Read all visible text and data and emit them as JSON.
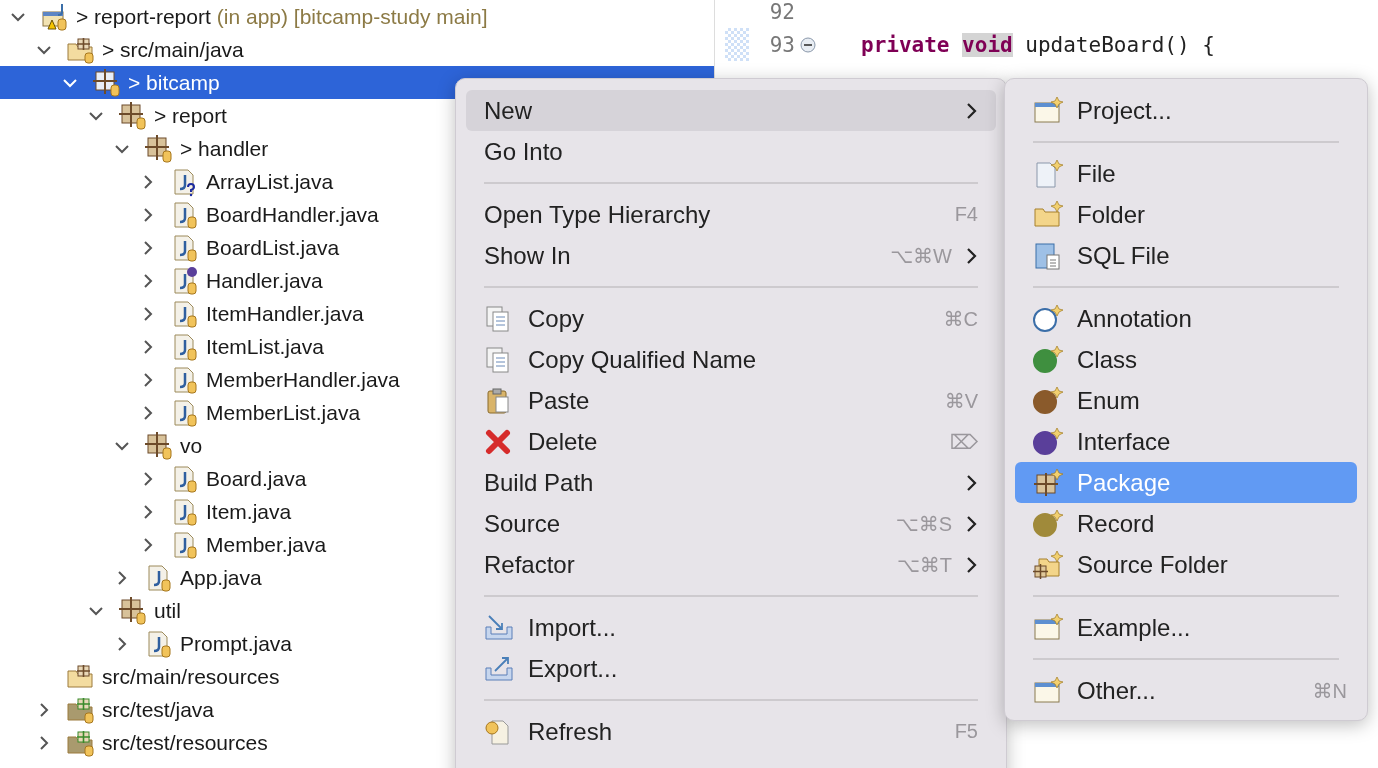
{
  "tree": [
    {
      "label": "> report-report",
      "decoration": "(in app) [bitcamp-study main]",
      "kind": "project",
      "expanded": true,
      "selected": false,
      "children": [
        {
          "label": "> src/main/java",
          "kind": "srcfolder",
          "expanded": true,
          "selected": false,
          "children": [
            {
              "label": "> bitcamp",
              "kind": "package",
              "expanded": true,
              "selected": true,
              "children": [
                {
                  "label": "> report",
                  "kind": "package",
                  "expanded": true,
                  "selected": false,
                  "children": [
                    {
                      "label": "> handler",
                      "kind": "package",
                      "expanded": true,
                      "selected": false,
                      "children": [
                        {
                          "label": "ArrayList.java",
                          "kind": "javaunknown",
                          "expanded": false,
                          "selected": false
                        },
                        {
                          "label": "BoardHandler.java",
                          "kind": "java",
                          "expanded": false,
                          "selected": false
                        },
                        {
                          "label": "BoardList.java",
                          "kind": "java",
                          "expanded": false,
                          "selected": false
                        },
                        {
                          "label": "Handler.java",
                          "kind": "javainterface",
                          "expanded": false,
                          "selected": false
                        },
                        {
                          "label": "ItemHandler.java",
                          "kind": "java",
                          "expanded": false,
                          "selected": false
                        },
                        {
                          "label": "ItemList.java",
                          "kind": "java",
                          "expanded": false,
                          "selected": false
                        },
                        {
                          "label": "MemberHandler.java",
                          "kind": "java",
                          "expanded": false,
                          "selected": false
                        },
                        {
                          "label": "MemberList.java",
                          "kind": "java",
                          "expanded": false,
                          "selected": false
                        }
                      ]
                    },
                    {
                      "label": "vo",
                      "kind": "package",
                      "expanded": true,
                      "selected": false,
                      "children": [
                        {
                          "label": "Board.java",
                          "kind": "java",
                          "expanded": false,
                          "selected": false
                        },
                        {
                          "label": "Item.java",
                          "kind": "java",
                          "expanded": false,
                          "selected": false
                        },
                        {
                          "label": "Member.java",
                          "kind": "java",
                          "expanded": false,
                          "selected": false
                        }
                      ]
                    },
                    {
                      "label": "App.java",
                      "kind": "java",
                      "expanded": false,
                      "selected": false
                    }
                  ]
                },
                {
                  "label": "util",
                  "kind": "package",
                  "expanded": true,
                  "selected": false,
                  "children": [
                    {
                      "label": "Prompt.java",
                      "kind": "java",
                      "expanded": false,
                      "selected": false
                    }
                  ]
                }
              ]
            }
          ]
        },
        {
          "label": "src/main/resources",
          "kind": "resfolder",
          "selected": false
        },
        {
          "label": "src/test/java",
          "kind": "testfolder",
          "expanded": false,
          "selected": false
        },
        {
          "label": "src/test/resources",
          "kind": "testfolder",
          "expanded": false,
          "selected": false
        }
      ]
    }
  ],
  "editor": {
    "lines": [
      {
        "number": "92"
      },
      {
        "number": "93",
        "folding": true,
        "tokens": [
          {
            "text": "private",
            "kind": "keyword"
          },
          {
            "text": "void",
            "kind": "occurrence"
          },
          {
            "text": "updateBoard() {",
            "kind": "plain"
          }
        ]
      }
    ]
  },
  "context_menu": {
    "items": [
      {
        "kind": "item",
        "label": "New",
        "submenu": true,
        "selected": true
      },
      {
        "kind": "item",
        "label": "Go Into",
        "selected": false
      },
      {
        "kind": "separator"
      },
      {
        "kind": "item",
        "label": "Open Type Hierarchy",
        "shortcut": "F4",
        "selected": false
      },
      {
        "kind": "item",
        "label": "Show In",
        "shortcut": "⌥⌘W",
        "submenu": true,
        "selected": false
      },
      {
        "kind": "separator"
      },
      {
        "kind": "item",
        "label": "Copy",
        "shortcut": "⌘C",
        "selected": false
      },
      {
        "kind": "item",
        "label": "Copy Qualified Name",
        "selected": false
      },
      {
        "kind": "item",
        "label": "Paste",
        "shortcut": "⌘V",
        "selected": false
      },
      {
        "kind": "item",
        "label": "Delete",
        "shortcut": "⌦",
        "selected": false
      },
      {
        "kind": "item",
        "label": "Build Path",
        "submenu": true,
        "selected": false
      },
      {
        "kind": "item",
        "label": "Source",
        "shortcut": "⌥⌘S",
        "submenu": true,
        "selected": false
      },
      {
        "kind": "item",
        "label": "Refactor",
        "shortcut": "⌥⌘T",
        "submenu": true,
        "selected": false
      },
      {
        "kind": "separator"
      },
      {
        "kind": "item",
        "label": "Import...",
        "selected": false
      },
      {
        "kind": "item",
        "label": "Export...",
        "selected": false
      },
      {
        "kind": "separator"
      },
      {
        "kind": "item",
        "label": "Refresh",
        "shortcut": "F5",
        "selected": false
      }
    ]
  },
  "submenu": {
    "items": [
      {
        "kind": "item",
        "label": "Project...",
        "selected": false
      },
      {
        "kind": "separator"
      },
      {
        "kind": "item",
        "label": "File",
        "selected": false
      },
      {
        "kind": "item",
        "label": "Folder",
        "selected": false
      },
      {
        "kind": "item",
        "label": "SQL File",
        "selected": false
      },
      {
        "kind": "separator"
      },
      {
        "kind": "item",
        "label": "Annotation",
        "selected": false
      },
      {
        "kind": "item",
        "label": "Class",
        "selected": false
      },
      {
        "kind": "item",
        "label": "Enum",
        "selected": false
      },
      {
        "kind": "item",
        "label": "Interface",
        "selected": false
      },
      {
        "kind": "item",
        "label": "Package",
        "selected": true
      },
      {
        "kind": "item",
        "label": "Record",
        "selected": false
      },
      {
        "kind": "item",
        "label": "Source Folder",
        "selected": false
      },
      {
        "kind": "separator"
      },
      {
        "kind": "item",
        "label": "Example...",
        "selected": false
      },
      {
        "kind": "separator"
      },
      {
        "kind": "item",
        "label": "Other...",
        "shortcut": "⌘N",
        "selected": false
      }
    ]
  }
}
